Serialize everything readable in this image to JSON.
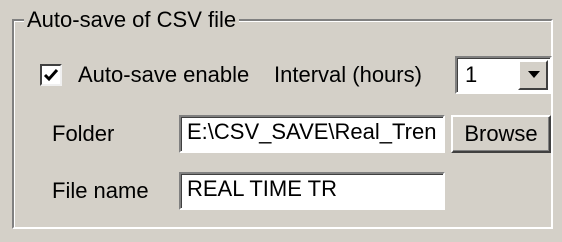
{
  "group": {
    "title": "Auto-save of CSV file"
  },
  "autosave": {
    "label": "Auto-save enable",
    "checked": true
  },
  "interval": {
    "label": "Interval (hours)",
    "value": "1"
  },
  "folder": {
    "label": "Folder",
    "value": "E:\\CSV_SAVE\\Real_Tren",
    "browse_label": "Browse"
  },
  "file_name": {
    "label": "File name",
    "value": "REAL TIME TR"
  },
  "icons": {
    "check": "checkmark-icon",
    "dropdown": "triangle-down-icon"
  },
  "colors": {
    "face": "#d4d0c8",
    "field": "#ffffff",
    "shadow": "#808080"
  }
}
